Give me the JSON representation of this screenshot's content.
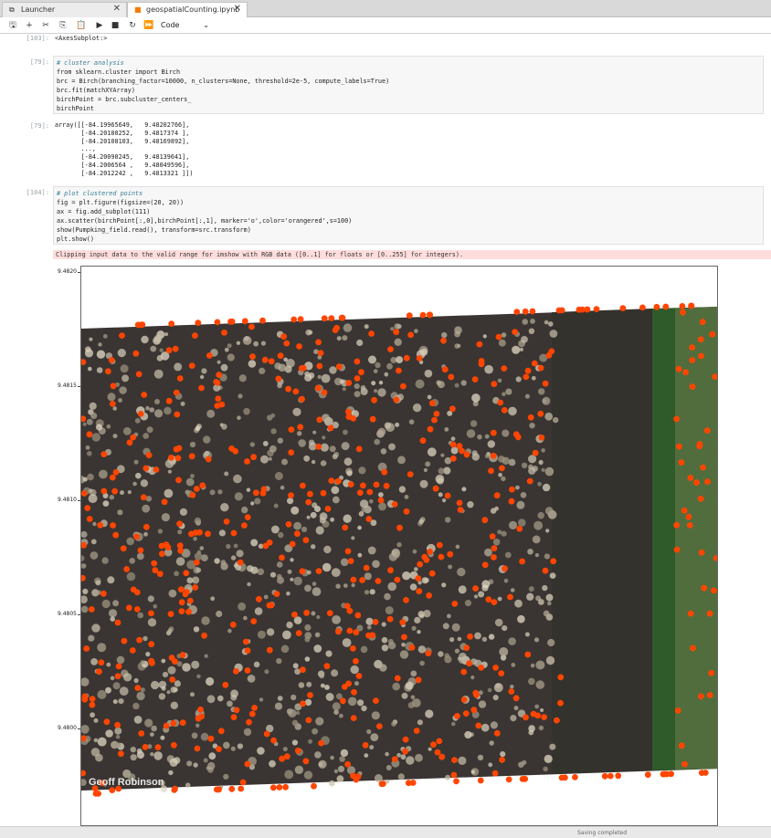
{
  "tabs": [
    {
      "label": "Launcher",
      "icon": "launcher-icon",
      "glyph": "⧉",
      "close": "✕"
    },
    {
      "label": "geospatialCounting.ipynb",
      "icon": "notebook-icon",
      "glyph": "■",
      "close": "✕"
    }
  ],
  "toolbar": {
    "buttons": [
      {
        "name": "save-icon",
        "glyph": "🖫"
      },
      {
        "name": "add-cell-icon",
        "glyph": "+"
      },
      {
        "name": "cut-icon",
        "glyph": "✂"
      },
      {
        "name": "copy-icon",
        "glyph": "⎘"
      },
      {
        "name": "paste-icon",
        "glyph": "📋"
      },
      {
        "name": "run-icon",
        "glyph": "▶"
      },
      {
        "name": "stop-icon",
        "glyph": "■"
      },
      {
        "name": "restart-icon",
        "glyph": "↻"
      },
      {
        "name": "fast-forward-icon",
        "glyph": "⏩"
      }
    ],
    "cell_type": "Code",
    "chevron": "⌄"
  },
  "cells": {
    "out103": {
      "prompt": "[103]:",
      "text": "<AxesSubplot:>"
    },
    "in79": {
      "prompt": "[79]:",
      "lines": [
        "# cluster analysis",
        "from sklearn.cluster import Birch",
        "brc = Birch(branching_factor=10000, n_clusters=None, threshold=2e-5, compute_labels=True)",
        "brc.fit(matchXYArray)",
        "birchPoint = brc.subcluster_centers_",
        "birchPoint"
      ]
    },
    "out79": {
      "prompt": "[79]:",
      "lines": [
        "array([[-84.19965649,   9.48202766],",
        "       [-84.20180252,   9.4817374 ],",
        "       [-84.20108103,   9.48169892],",
        "       ...,",
        "       [-84.20090245,   9.48139641],",
        "       [-84.2006564 ,   9.48049596],",
        "       [-84.2012242 ,   9.4813321 ]])"
      ]
    },
    "in104": {
      "prompt": "[104]:",
      "lines": [
        "# plot clustered points",
        "fig = plt.figure(figsize=(20, 20))",
        "ax = fig.add_subplot(111)",
        "ax.scatter(birchPoint[:,0],birchPoint[:,1], marker='o',color='orangered',s=100)",
        "show(Pumpking_field.read(), transform=src.transform)",
        "plt.show()"
      ]
    },
    "warning": "Clipping input data to the valid range for imshow with RGB data ([0..1] for floats or [0..255] for integers)."
  },
  "plot": {
    "yticks": [
      "9.4820",
      "9.4815",
      "9.4810",
      "9.4805",
      "9.4800"
    ],
    "watermark": "Geoff Robinson",
    "marker_color": "#ff4500",
    "soil_color": "#3a3533"
  },
  "status": {
    "text": "Saving completed"
  }
}
